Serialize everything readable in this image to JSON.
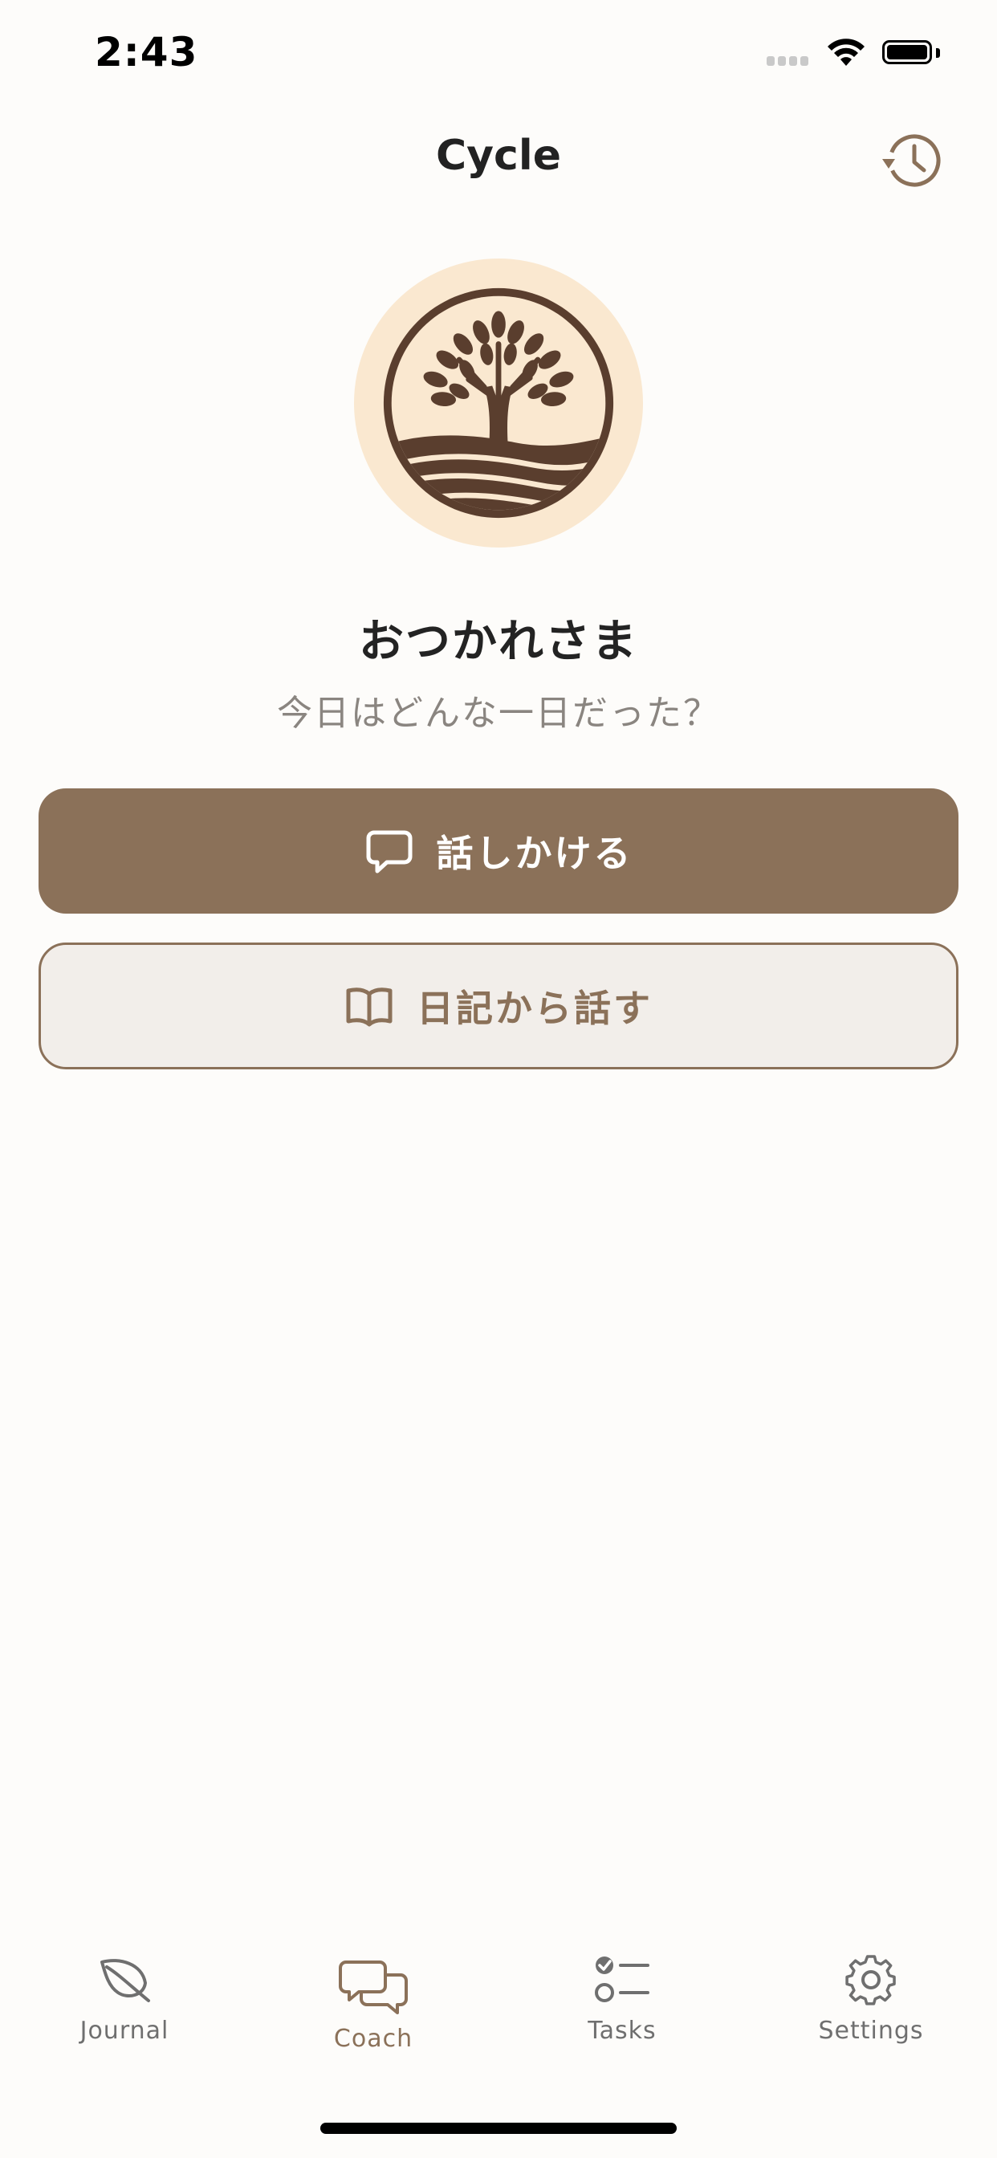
{
  "status_bar": {
    "time": "2:43"
  },
  "header": {
    "title": "Cycle",
    "history_icon": "history-icon"
  },
  "hero": {
    "logo_icon": "tree-icon",
    "greeting": "おつかれさま",
    "subtitle": "今日はどんな一日だった？"
  },
  "actions": {
    "talk_label": "話しかける",
    "talk_icon": "chat-bubble-icon",
    "diary_label": "日記から話す",
    "diary_icon": "book-icon"
  },
  "tab_bar": {
    "items": [
      {
        "label": "Journal",
        "icon": "leaf-icon",
        "active": false
      },
      {
        "label": "Coach",
        "icon": "chat-bubbles-icon",
        "active": true
      },
      {
        "label": "Tasks",
        "icon": "checklist-icon",
        "active": false
      },
      {
        "label": "Settings",
        "icon": "gear-icon",
        "active": false
      }
    ]
  },
  "colors": {
    "accent": "#8B7159",
    "background": "#FDFCFA",
    "avatar_bg": "#FAE8D0",
    "logo_dark": "#5A3E2E",
    "secondary_button_bg": "#F2EEEA"
  }
}
